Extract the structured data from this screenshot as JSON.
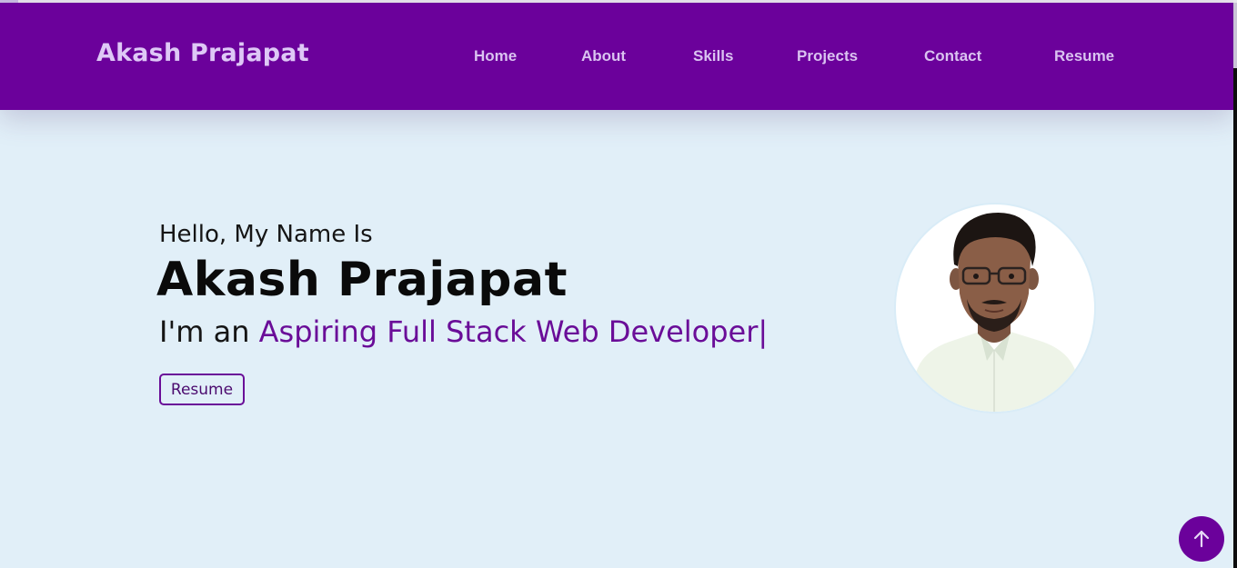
{
  "header": {
    "brand": "Akash Prajapat",
    "nav": [
      {
        "label": "Home"
      },
      {
        "label": "About"
      },
      {
        "label": "Skills"
      },
      {
        "label": "Projects"
      },
      {
        "label": "Contact"
      },
      {
        "label": "Resume"
      }
    ]
  },
  "hero": {
    "greeting": "Hello, My Name Is",
    "name": "Akash Prajapat",
    "role_prefix": "I'm an ",
    "role_typed": "Aspiring Full Stack Web Developer|",
    "resume_label": "Resume"
  },
  "icons": {
    "scroll_top": "arrow-up-icon",
    "profile": "profile-photo"
  },
  "colors": {
    "brand_purple": "#6b019b",
    "nav_text": "#dac3f1",
    "accent_text": "#6a0d98",
    "page_bg": "#e1eff8"
  }
}
